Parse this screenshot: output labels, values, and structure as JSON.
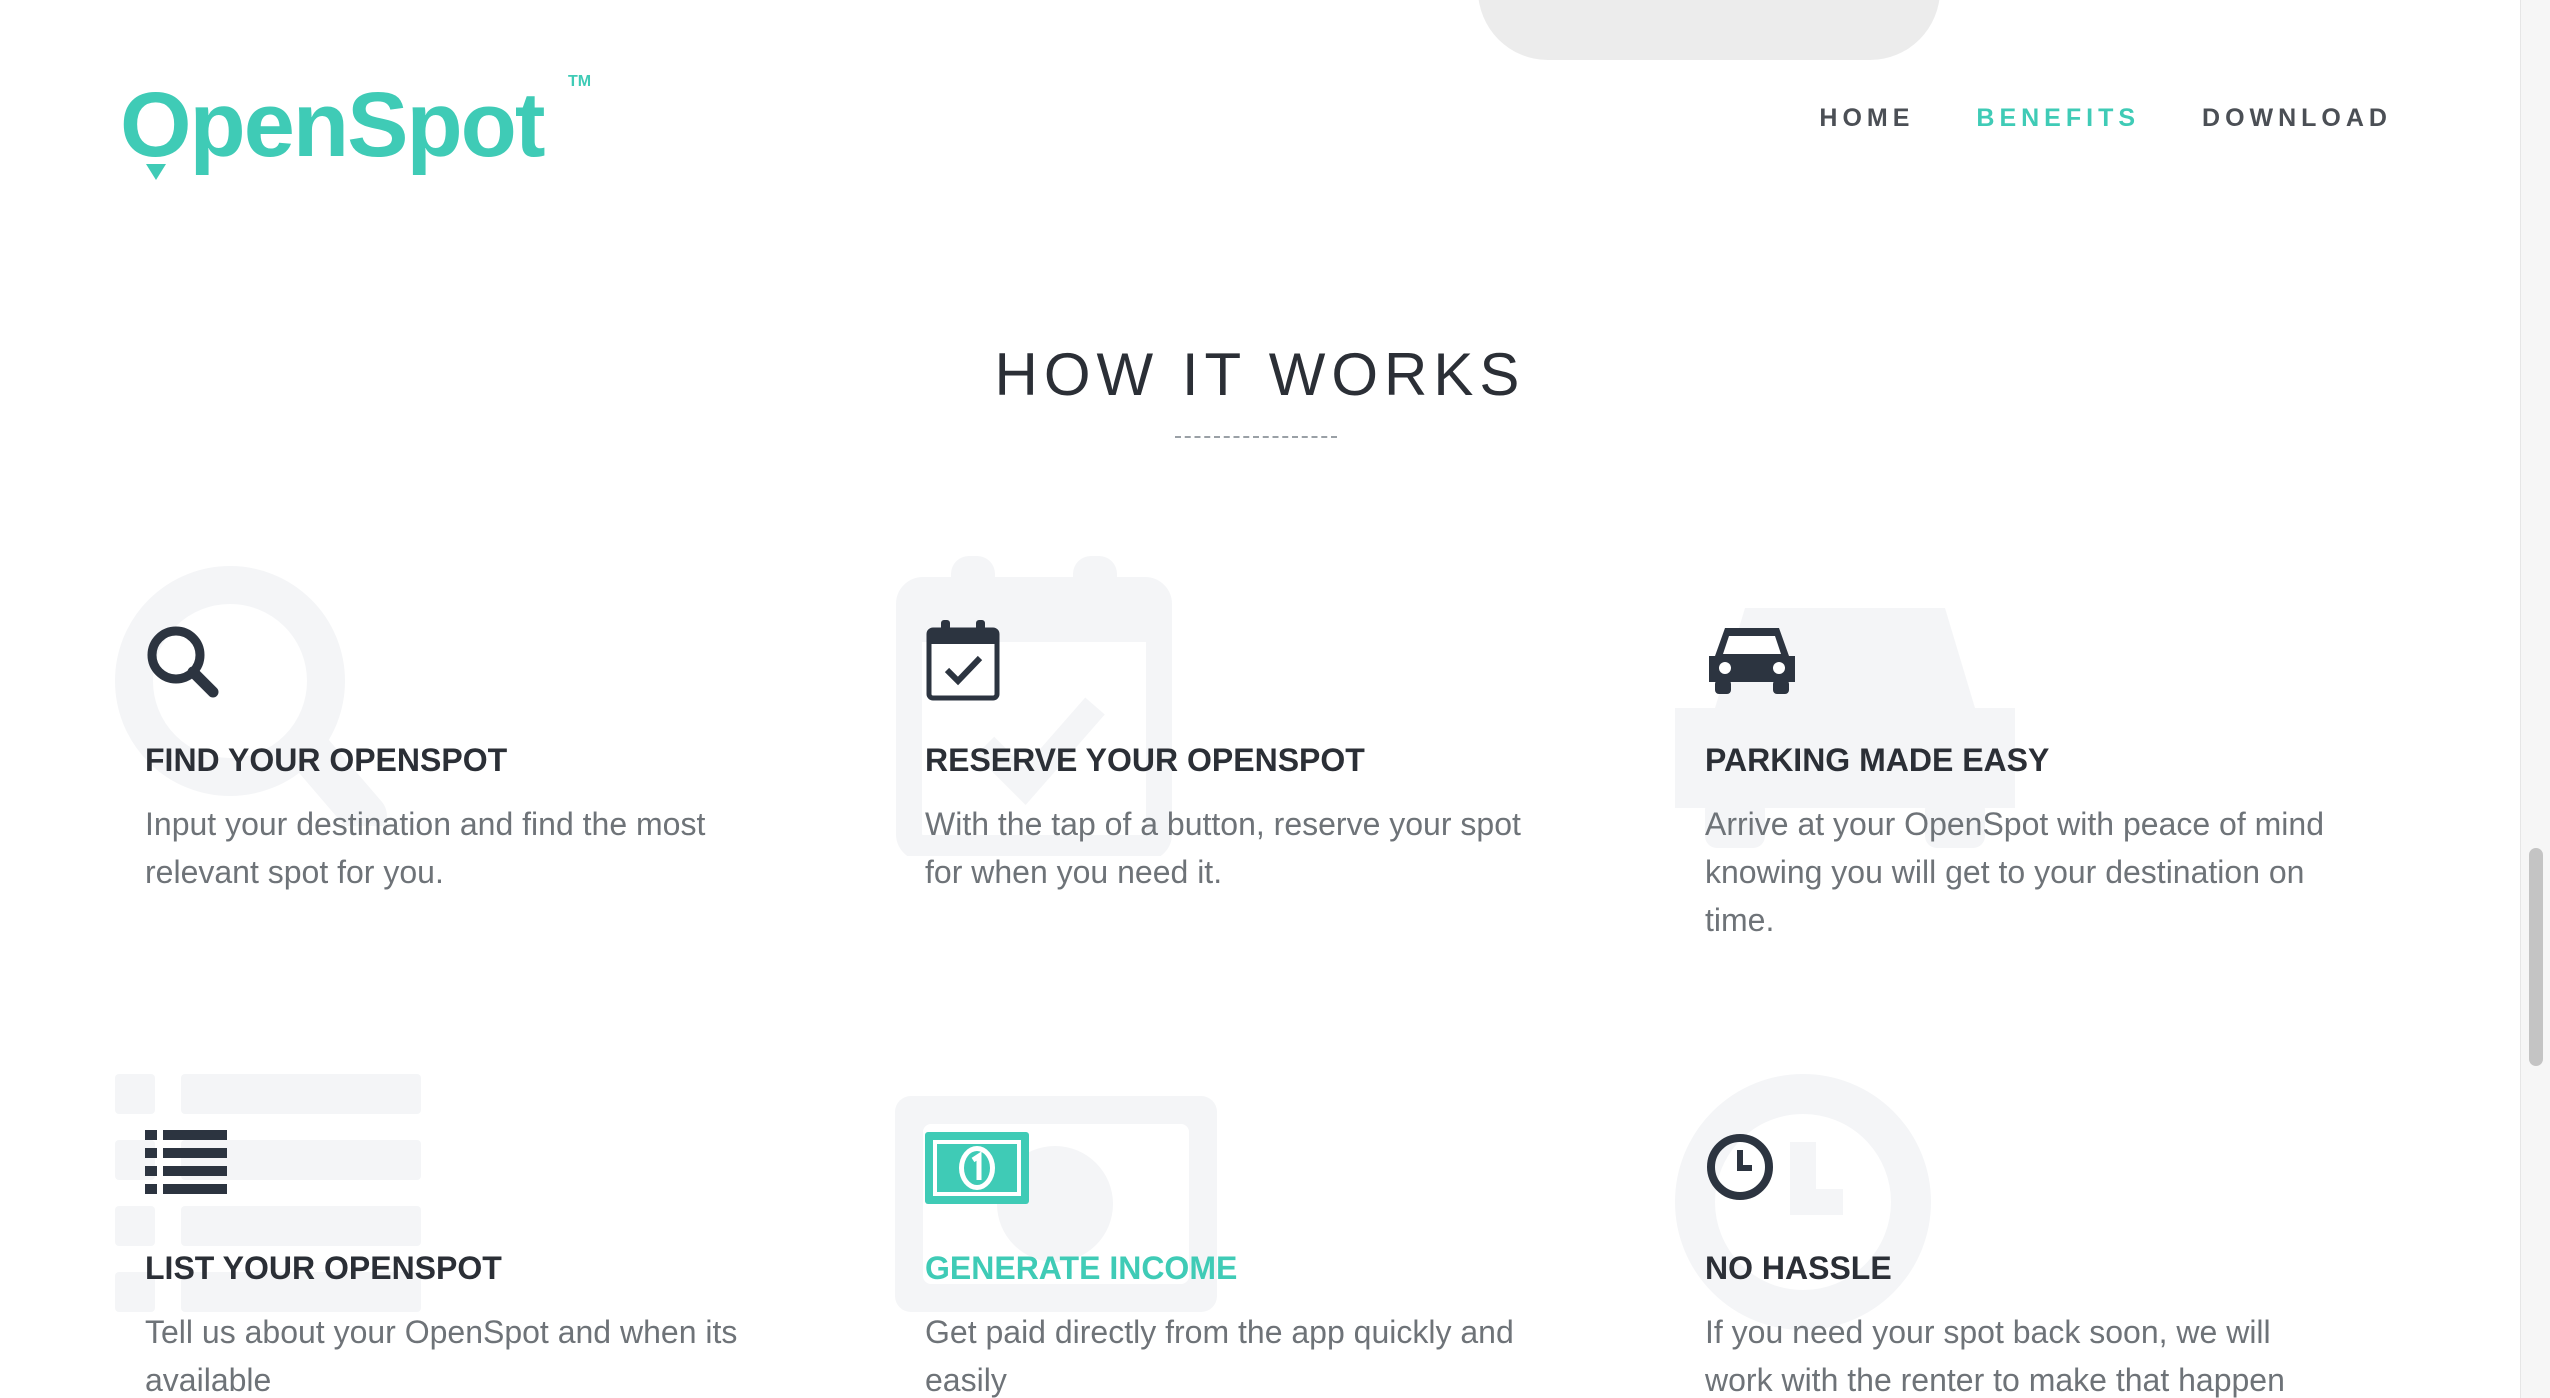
{
  "brand": {
    "name": "OpenSpot",
    "trademark": "TM",
    "color": "#3fcbb6"
  },
  "nav": {
    "items": [
      {
        "label": "HOME",
        "active": false
      },
      {
        "label": "BENEFITS",
        "active": true
      },
      {
        "label": "DOWNLOAD",
        "active": false
      }
    ]
  },
  "section": {
    "title": "HOW IT WORKS"
  },
  "features": [
    {
      "icon": "search-icon",
      "title": "FIND YOUR OPENSPOT",
      "text": "Input your destination and find the most relevant spot for you."
    },
    {
      "icon": "calendar-check-icon",
      "title": "RESERVE YOUR OPENSPOT",
      "text": "With the tap of a button, reserve your spot for when you need it."
    },
    {
      "icon": "car-icon",
      "title": "PARKING MADE EASY",
      "text": "Arrive at your OpenSpot with peace of mind knowing you will get to your destination on time."
    },
    {
      "icon": "list-icon",
      "title": "LIST YOUR OPENSPOT",
      "text": "Tell us about your OpenSpot and when its available"
    },
    {
      "icon": "money-bill-icon",
      "title": "GENERATE INCOME",
      "text": "Get paid directly from the app quickly and easily",
      "highlighted": true
    },
    {
      "icon": "clock-icon",
      "title": "NO HASSLE",
      "text": "If you need your spot back soon, we will work with the renter to make that happen"
    }
  ],
  "colors": {
    "accent": "#3fcbb6",
    "heading": "#2b2f36",
    "body_text": "#6e7378",
    "icon_dark": "#2c3440",
    "watermark": "#f4f5f7"
  }
}
